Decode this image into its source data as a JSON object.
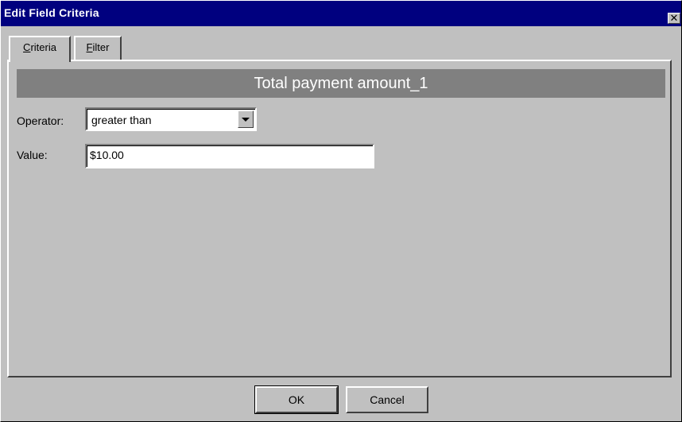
{
  "window": {
    "title": "Edit Field Criteria",
    "close_glyph": "✕"
  },
  "tabs": [
    {
      "label": "Criteria",
      "underline_char": "C",
      "rest": "riteria",
      "active": true
    },
    {
      "label": "Filter",
      "underline_char": "F",
      "rest": "ilter",
      "active": false
    }
  ],
  "panel": {
    "header": "Total payment amount_1",
    "operator": {
      "label": "Operator:",
      "selected": "greater than"
    },
    "value": {
      "label": "Value:",
      "current": "$10.00"
    }
  },
  "buttons": {
    "ok": "OK",
    "cancel": "Cancel"
  },
  "colors": {
    "titlebar": "#00007f",
    "header_bar": "#808080",
    "face": "#c0c0c0"
  }
}
